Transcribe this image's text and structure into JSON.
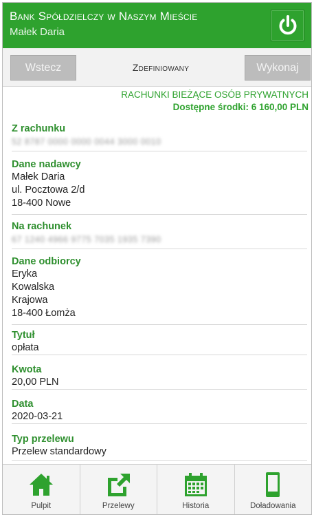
{
  "header": {
    "bank_name": "Bank Spółdzielczy w Naszym Mieście",
    "user_name": "Małek Daria",
    "power_icon": "power-icon"
  },
  "toolbar": {
    "back_label": "Wstecz",
    "title": "Zdefiniowany",
    "execute_label": "Wykonaj"
  },
  "account": {
    "type": "RACHUNKI BIEŻĄCE OSÓB PRYWATNYCH",
    "funds": "Dostępne środki: 6 160,00 PLN"
  },
  "fields": {
    "from_account": {
      "label": "Z rachunku",
      "value": "52 8787 0000 0000 0044 3000 0010"
    },
    "sender": {
      "label": "Dane nadawcy",
      "lines": [
        "Małek Daria",
        "ul. Pocztowa 2/d",
        "18-400 Nowe"
      ]
    },
    "to_account": {
      "label": "Na rachunek",
      "value": "67 1240 4966 9775 7035 1935 7390"
    },
    "recipient": {
      "label": "Dane odbiorcy",
      "lines": [
        "Eryka",
        "Kowalska",
        "Krajowa",
        "18-400 Łomża"
      ]
    },
    "title": {
      "label": "Tytuł",
      "value": "opłata"
    },
    "amount": {
      "label": "Kwota",
      "value": "20,00 PLN"
    },
    "date": {
      "label": "Data",
      "value": "2020-03-21"
    },
    "transfer_type": {
      "label": "Typ przelewu",
      "value": "Przelew standardowy"
    }
  },
  "bottom_nav": [
    {
      "label": "Pulpit",
      "icon": "home-icon"
    },
    {
      "label": "Przelewy",
      "icon": "external-link-icon"
    },
    {
      "label": "Historia",
      "icon": "calendar-icon"
    },
    {
      "label": "Doładowania",
      "icon": "phone-icon"
    }
  ],
  "colors": {
    "brand": "#2ea22e",
    "label_green": "#2e8f2e",
    "button_gray": "#bcbcbc"
  }
}
